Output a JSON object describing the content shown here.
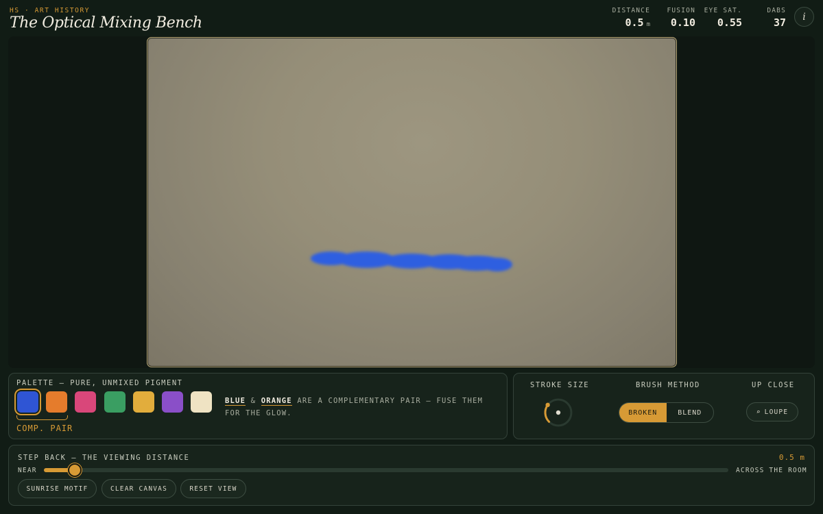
{
  "header": {
    "eyebrow": "HS · ART HISTORY",
    "title": "The Optical Mixing Bench",
    "stats": [
      {
        "label": "DISTANCE",
        "value": "0.5",
        "unit": "m"
      },
      {
        "label": "FUSION",
        "value": "0.10"
      },
      {
        "label": "EYE SAT.",
        "value": "0.55"
      },
      {
        "label": "DABS",
        "value": "37"
      }
    ],
    "info_label": "i"
  },
  "canvas": {
    "stroke_color": "#2f5fe0",
    "background_color": "#958e78"
  },
  "palette": {
    "title": "PALETTE — PURE, UNMIXED PIGMENT",
    "swatches": [
      {
        "name": "blue",
        "color": "#2f55d4",
        "selected": true
      },
      {
        "name": "orange",
        "color": "#e57c2c"
      },
      {
        "name": "rose",
        "color": "#d9477a"
      },
      {
        "name": "green",
        "color": "#3a9e62"
      },
      {
        "name": "yellow",
        "color": "#e2ad3c"
      },
      {
        "name": "violet",
        "color": "#8a4fc8"
      },
      {
        "name": "cream",
        "color": "#efe3c3"
      }
    ],
    "selection_label": "COMP. PAIR",
    "hint_word1": "BLUE",
    "hint_amp": "&",
    "hint_word2": "ORANGE",
    "hint_rest": "ARE A COMPLEMENTARY PAIR — FUSE THEM FOR THE GLOW."
  },
  "tools": {
    "stroke_size_title": "STROKE SIZE",
    "stroke_size_level": 0.3,
    "brush_method_title": "BRUSH METHOD",
    "brush_options": [
      "BROKEN",
      "BLEND"
    ],
    "brush_selected": "BROKEN",
    "up_close_title": "UP CLOSE",
    "loupe_label": "LOUPE",
    "loupe_icon": "⌕"
  },
  "viewing": {
    "title": "STEP BACK — THE VIEWING DISTANCE",
    "value": "0.5 m",
    "near_label": "NEAR",
    "far_label": "ACROSS THE ROOM",
    "slider_fraction": 0.045
  },
  "actions": {
    "sunrise": "SUNRISE MOTIF",
    "clear": "CLEAR CANVAS",
    "reset": "RESET VIEW"
  },
  "colors": {
    "accent": "#d79a35",
    "background": "#111c15",
    "panel": "#17231b"
  }
}
